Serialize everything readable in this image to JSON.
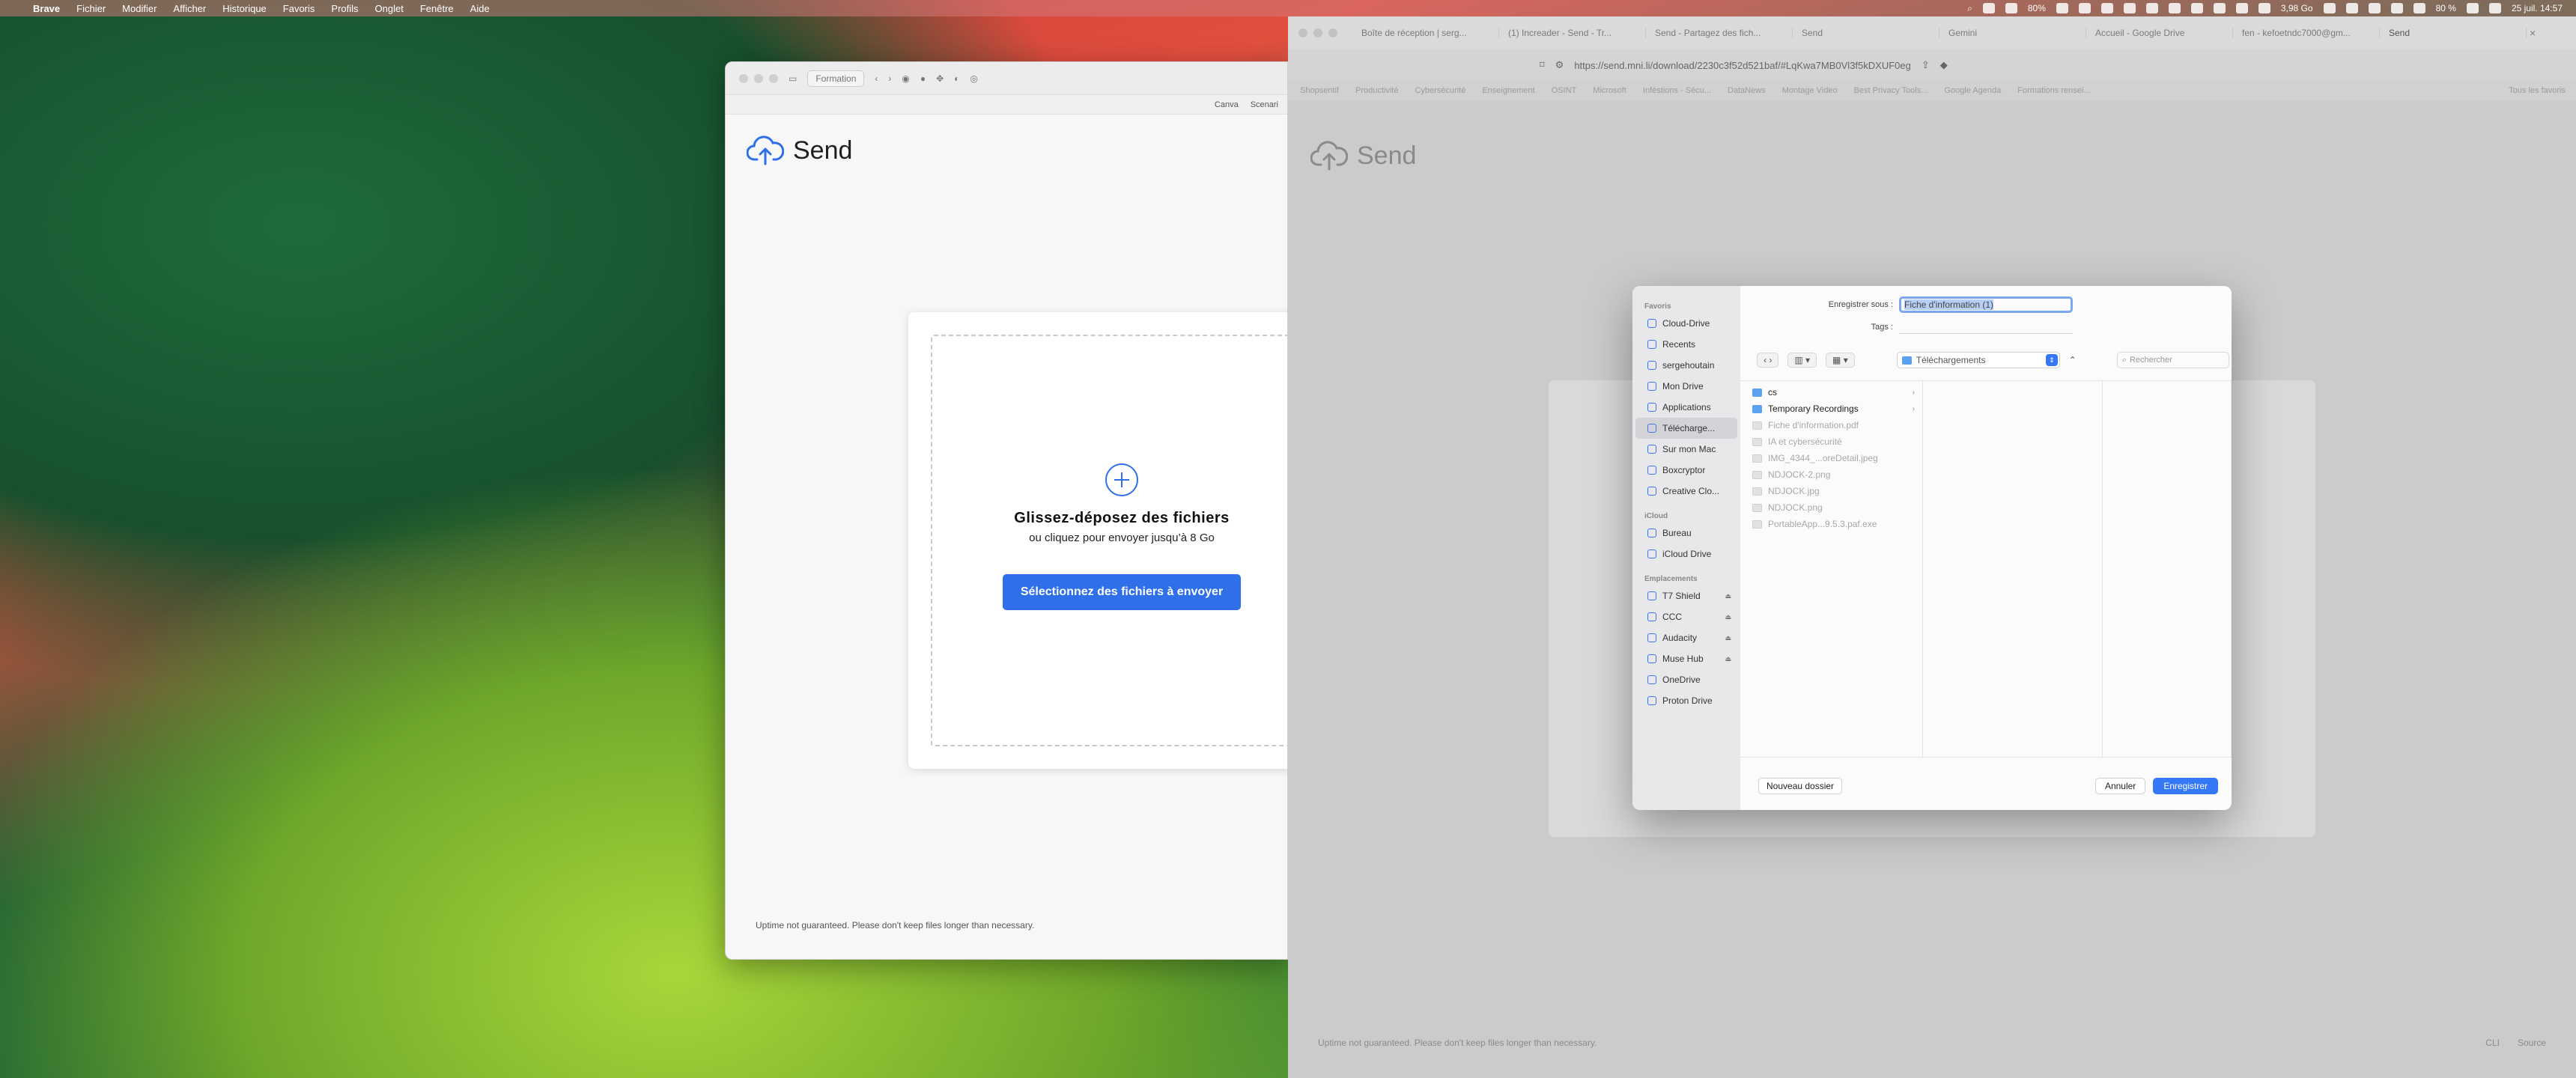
{
  "menubar": {
    "app": "Brave",
    "items": [
      "Fichier",
      "Modifier",
      "Afficher",
      "Historique",
      "Favoris",
      "Profils",
      "Onglet",
      "Fenêtre",
      "Aide"
    ],
    "battery_a": "80%",
    "storage": "3,98 Go",
    "battery_b": "80 %",
    "datetime": "25 juil. 14:57"
  },
  "left_window": {
    "profile": "Formation",
    "bookmarks": [
      "Canva",
      "Scenari"
    ],
    "logo": "Send",
    "drop_title": "Glissez-déposez des fichiers",
    "drop_sub": "ou cliquez pour envoyer jusqu’à 8 Go",
    "select_button": "Sélectionnez des fichiers à envoyer",
    "footer": "Uptime not guaranteed. Please don't keep files longer than necessary."
  },
  "right_window": {
    "tabs": [
      "Boîte de réception | serg...",
      "(1) Increader - Send - Tr...",
      "Send - Partagez des fich...",
      "Send",
      "Gemini",
      "Accueil - Google Drive",
      "fen - kefoetndc7000@gm...",
      "Send"
    ],
    "url": "https://send.mni.li/download/2230c3f52d521baf/#LqKwa7MB0Vl3f5kDXUF0eg",
    "bookmarks": [
      "Shopsentif",
      "Productivité",
      "Cybersécurité",
      "Enseignement",
      "OSINT",
      "Microsoft",
      "Inféstions - Sécu...",
      "DataNews",
      "Montage Video",
      "Best Privacy Tools...",
      "Google Agenda",
      "Formations rensei..."
    ],
    "all_favorites": "Tous les favoris",
    "logo": "Send",
    "footer": "Uptime not guaranteed. Please don't keep files longer than necessary.",
    "footer_links": [
      "CLI",
      "Source"
    ]
  },
  "dialog": {
    "sidebar": {
      "favorites_title": "Favoris",
      "favorites": [
        "Cloud-Drive",
        "Recents",
        "sergehoutain",
        "Mon Drive",
        "Applications",
        "Télécharge...",
        "Sur mon Mac",
        "Boxcryptor",
        "Creative Clo..."
      ],
      "icloud_title": "iCloud",
      "icloud": [
        "Bureau",
        "iCloud Drive"
      ],
      "locations_title": "Emplacements",
      "locations": [
        "T7 Shield",
        "CCC",
        "Audacity",
        "Muse Hub",
        "OneDrive",
        "Proton Drive"
      ]
    },
    "save_as_label": "Enregistrer sous :",
    "filename": "Fiche d'information (1)",
    "tags_label": "Tags :",
    "location": "Téléchargements",
    "search_placeholder": "Rechercher",
    "files": [
      {
        "name": "cs",
        "type": "folder",
        "enabled": true
      },
      {
        "name": "Temporary Recordings",
        "type": "folder",
        "enabled": true
      },
      {
        "name": "Fiche d'information.pdf",
        "type": "doc",
        "enabled": false
      },
      {
        "name": "IA et cybersécurité",
        "type": "doc",
        "enabled": false
      },
      {
        "name": "IMG_4344_...oreDetail.jpeg",
        "type": "doc",
        "enabled": false
      },
      {
        "name": "NDJOCK-2.png",
        "type": "doc",
        "enabled": false
      },
      {
        "name": "NDJOCK.jpg",
        "type": "doc",
        "enabled": false
      },
      {
        "name": "NDJOCK.png",
        "type": "doc",
        "enabled": false
      },
      {
        "name": "PortableApp...9.5.3.paf.exe",
        "type": "doc",
        "enabled": false
      }
    ],
    "new_folder": "Nouveau dossier",
    "cancel": "Annuler",
    "save": "Enregistrer"
  }
}
